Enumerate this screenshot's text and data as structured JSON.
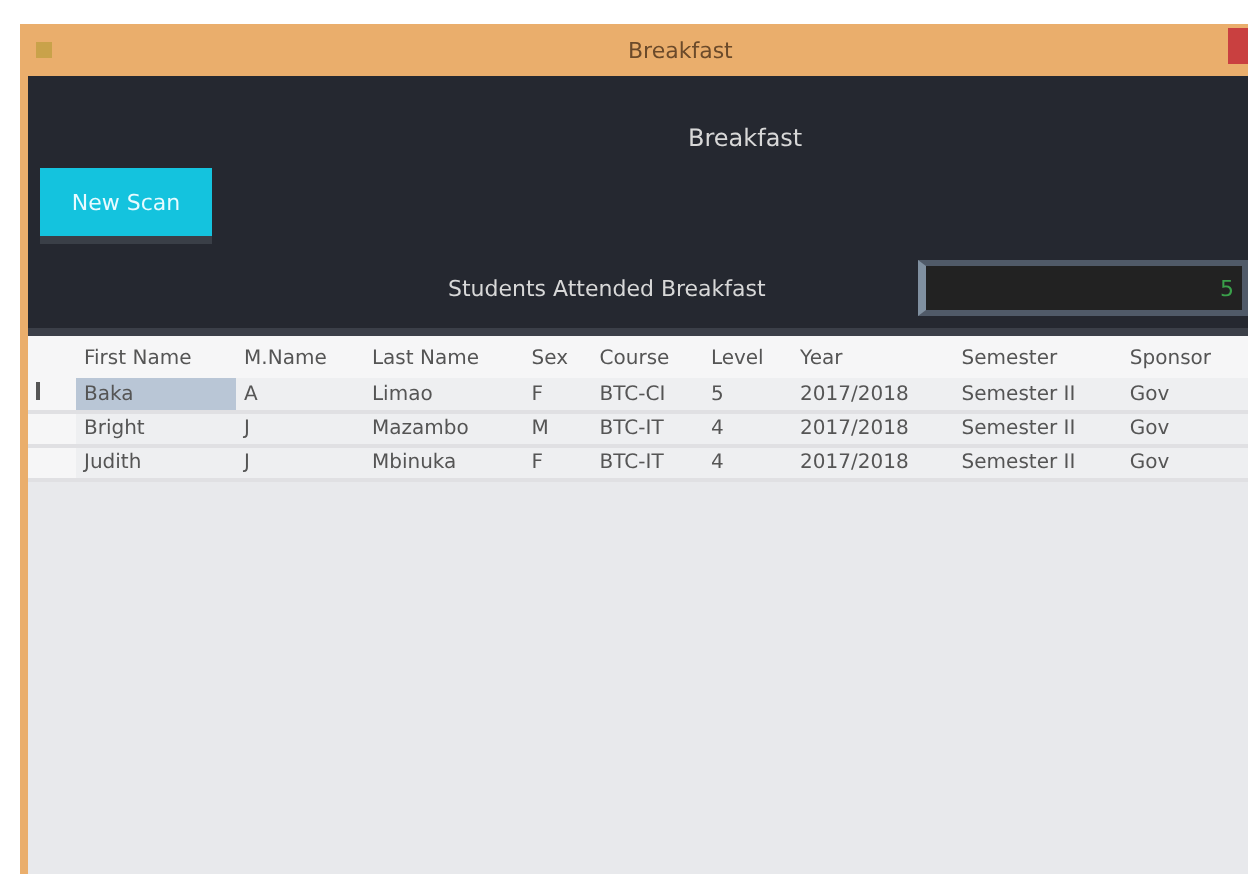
{
  "window": {
    "title": "Breakfast"
  },
  "header": {
    "title": "Breakfast",
    "new_scan_button": "New Scan",
    "caption": "Students Attended Breakfast",
    "count_field": {
      "value": "5"
    }
  },
  "table": {
    "columns": [
      "First Name",
      "M.Name",
      "Last Name",
      "Sex",
      "Course",
      "Level",
      "Year",
      "Semester",
      "Sponsor"
    ],
    "rows": [
      {
        "selected": true,
        "cells": [
          "Baka",
          "A",
          "Limao",
          "F",
          "BTC-CI",
          "5",
          "2017/2018",
          "Semester II",
          "Gov"
        ]
      },
      {
        "selected": false,
        "cells": [
          "Bright",
          "J",
          "Mazambo",
          "M",
          "BTC-IT",
          "4",
          "2017/2018",
          "Semester II",
          "Gov"
        ]
      },
      {
        "selected": false,
        "cells": [
          "Judith",
          "J",
          "Mbinuka",
          "F",
          "BTC-IT",
          "4",
          "2017/2018",
          "Semester II",
          "Gov"
        ]
      }
    ]
  }
}
